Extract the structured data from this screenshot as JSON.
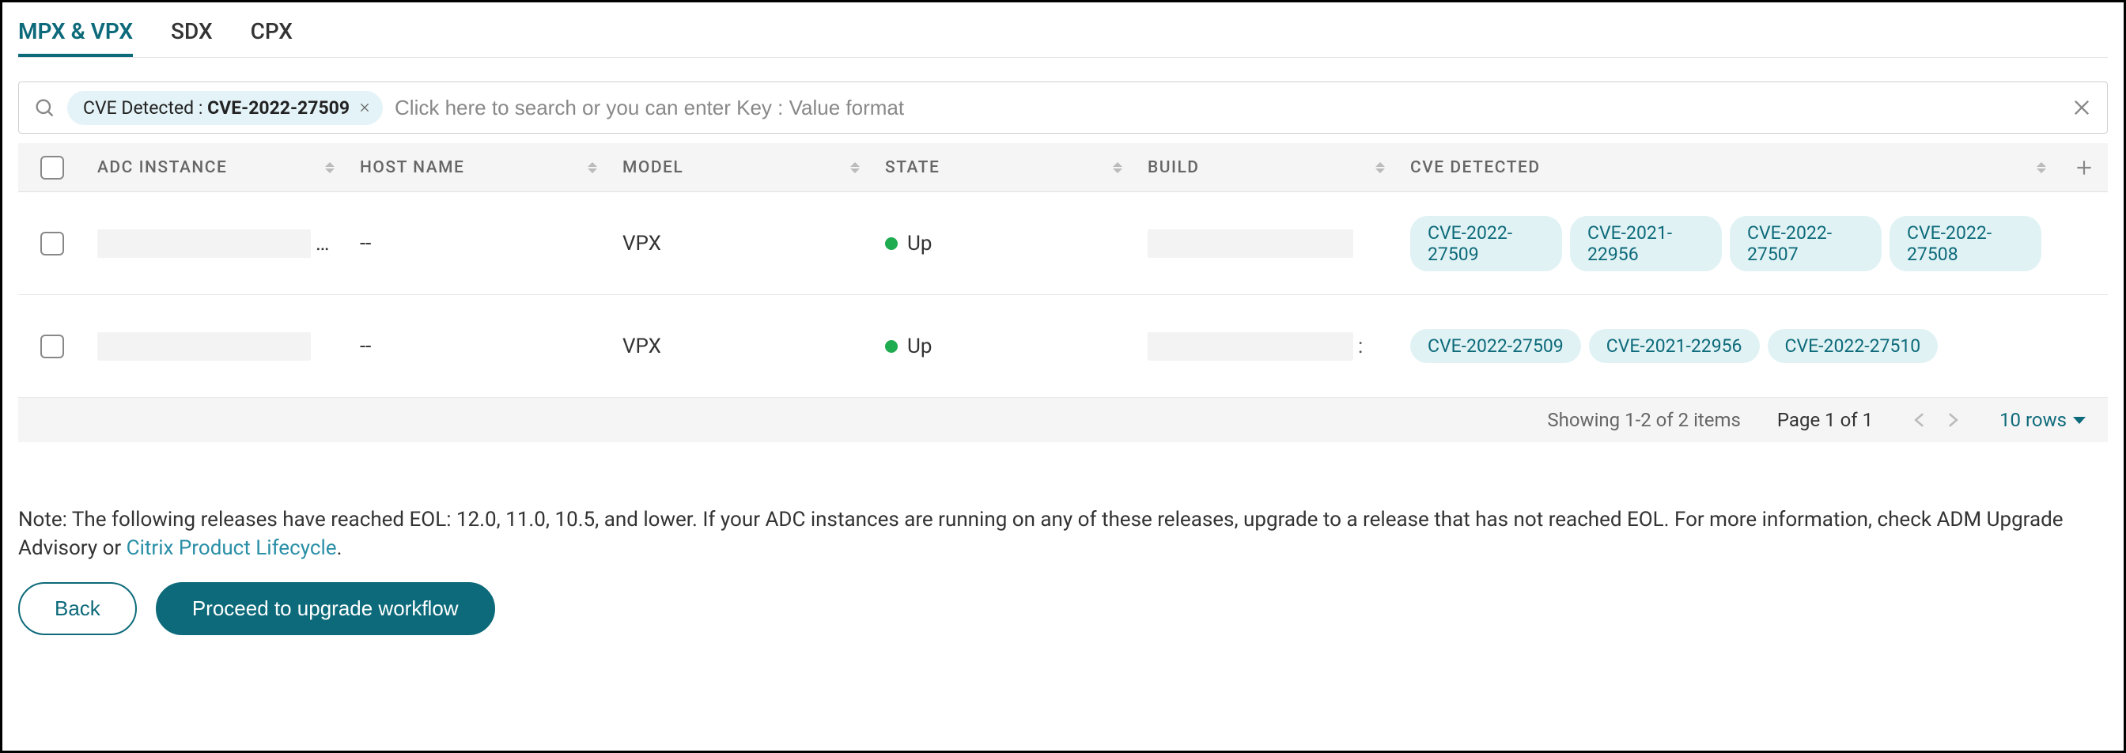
{
  "tabs": {
    "active": "MPX & VPX",
    "items": [
      "MPX & VPX",
      "SDX",
      "CPX"
    ]
  },
  "search": {
    "chip_label": "CVE Detected : ",
    "chip_value": "CVE-2022-27509",
    "placeholder": "Click here to search or you can enter Key : Value format"
  },
  "columns": {
    "instance": "ADC INSTANCE",
    "host": "HOST NAME",
    "model": "MODEL",
    "state": "STATE",
    "build": "BUILD",
    "cve": "CVE DETECTED"
  },
  "rows": [
    {
      "instance_suffix": "…",
      "host": "--",
      "model": "VPX",
      "state": "Up",
      "build_suffix": "",
      "cves": [
        "CVE-2022-27509",
        "CVE-2021-22956",
        "CVE-2022-27507",
        "CVE-2022-27508"
      ]
    },
    {
      "instance_suffix": "",
      "host": "--",
      "model": "VPX",
      "state": "Up",
      "build_suffix": ":",
      "cves": [
        "CVE-2022-27509",
        "CVE-2021-22956",
        "CVE-2022-27510"
      ]
    }
  ],
  "pagination": {
    "summary": "Showing 1-2 of 2 items",
    "page": "Page 1 of 1",
    "rows": "10 rows"
  },
  "note": {
    "text_before": "Note: The following releases have reached EOL: 12.0, 11.0, 10.5, and lower. If your ADC instances are running on any of these releases, upgrade to a release that has not reached EOL. For more information, check ADM Upgrade Advisory or ",
    "link_text": "Citrix Product Lifecycle",
    "text_after": "."
  },
  "buttons": {
    "back": "Back",
    "proceed": "Proceed to upgrade workflow"
  }
}
